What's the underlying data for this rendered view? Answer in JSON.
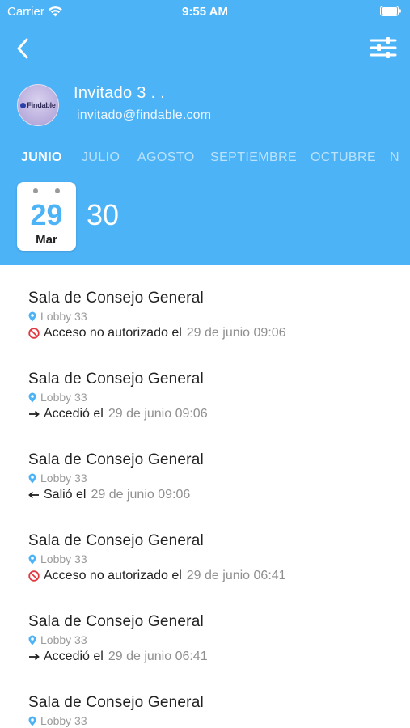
{
  "status_bar": {
    "carrier": "Carrier",
    "time": "9:55 AM"
  },
  "user": {
    "name": "Invitado 3 . .",
    "email": "invitado@findable.com",
    "avatar_logo": "Findable"
  },
  "months": [
    {
      "label": "JUNIO",
      "active": true
    },
    {
      "label": "JULIO",
      "active": false
    },
    {
      "label": "AGOSTO",
      "active": false
    },
    {
      "label": "SEPTIEMBRE",
      "active": false
    },
    {
      "label": "OCTUBRE",
      "active": false
    },
    {
      "label": "N",
      "active": false
    }
  ],
  "selected_date": {
    "day": "29",
    "month": "Mar"
  },
  "next_day": "30",
  "colors": {
    "primary": "#4db3f7",
    "denied": "#e0383e",
    "location_pin": "#4db3f7"
  },
  "events": [
    {
      "title": "Sala de Consejo General",
      "location": "Lobby 33",
      "icon": "no-entry-icon",
      "action": "Acceso no autorizado el",
      "timestamp": "29 de junio 09:06"
    },
    {
      "title": "Sala de Consejo General",
      "location": "Lobby 33",
      "icon": "arrow-right-icon",
      "action": "Accedió el",
      "timestamp": "29 de junio 09:06"
    },
    {
      "title": "Sala de Consejo General",
      "location": "Lobby 33",
      "icon": "arrow-left-icon",
      "action": "Salió el",
      "timestamp": "29 de junio 09:06"
    },
    {
      "title": "Sala de Consejo General",
      "location": "Lobby 33",
      "icon": "no-entry-icon",
      "action": "Acceso no autorizado el",
      "timestamp": "29 de junio 06:41"
    },
    {
      "title": "Sala de Consejo General",
      "location": "Lobby 33",
      "icon": "arrow-right-icon",
      "action": "Accedió el",
      "timestamp": "29 de junio 06:41"
    },
    {
      "title": "Sala de Consejo General",
      "location": "Lobby 33",
      "icon": "",
      "action": "",
      "timestamp": ""
    }
  ]
}
